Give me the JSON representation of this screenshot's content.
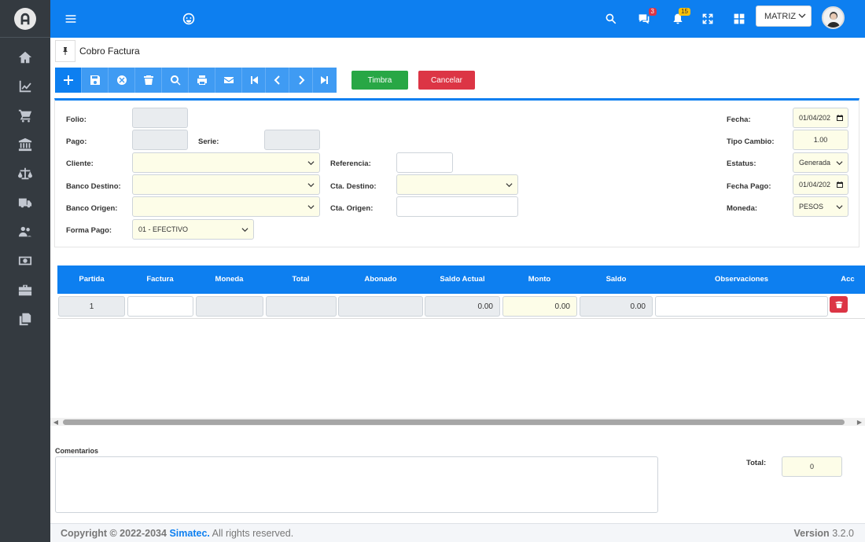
{
  "nav": {
    "store_selector": "MATRIZ",
    "messages_badge": "3",
    "notifications_badge": "15"
  },
  "page": {
    "title": "Cobro Factura"
  },
  "actions": {
    "timbra": "Timbra",
    "cancelar": "Cancelar"
  },
  "form": {
    "folio_label": "Folio:",
    "folio_value": "",
    "pago_label": "Pago:",
    "pago_value": "",
    "serie_label": "Serie:",
    "serie_value": "",
    "cliente_label": "Cliente:",
    "cliente_value": "",
    "banco_destino_label": "Banco Destino:",
    "banco_destino_value": "",
    "banco_origen_label": "Banco Origen:",
    "banco_origen_value": "",
    "forma_pago_label": "Forma Pago:",
    "forma_pago_value": "01 - EFECTIVO",
    "referencia_label": "Referencia:",
    "referencia_value": "",
    "cta_destino_label": "Cta. Destino:",
    "cta_destino_value": "",
    "cta_origen_label": "Cta. Origen:",
    "cta_origen_value": "",
    "fecha_label": "Fecha:",
    "fecha_value": "01/04/202",
    "tipo_cambio_label": "Tipo Cambio:",
    "tipo_cambio_value": "1.00",
    "estatus_label": "Estatus:",
    "estatus_value": "Generada",
    "fecha_pago_label": "Fecha Pago:",
    "fecha_pago_value": "01/04/202",
    "moneda_label": "Moneda:",
    "moneda_value": "PESOS"
  },
  "table": {
    "headers": [
      "Partida",
      "Factura",
      "Moneda",
      "Total",
      "Abonado",
      "Saldo Actual",
      "Monto",
      "Saldo",
      "Observaciones",
      "Acc"
    ],
    "rows": [
      {
        "partida": "1",
        "factura": "",
        "moneda": "",
        "total": "",
        "abonado": "",
        "saldo_actual": "0.00",
        "monto": "0.00",
        "saldo": "0.00",
        "observaciones": ""
      }
    ]
  },
  "comments": {
    "label": "Comentarios",
    "value": ""
  },
  "total": {
    "label": "Total:",
    "value": "0"
  },
  "footer": {
    "copyright_prefix": "Copyright © 2022-2034",
    "brand": "Simatec.",
    "suffix": "All rights reserved.",
    "version_label": "Version",
    "version_value": "3.2.0"
  },
  "colors": {
    "primary": "#0d7ff0",
    "sidebar": "#343a40",
    "success": "#28a745",
    "danger": "#dc3545",
    "cream_input": "#fdfde8"
  }
}
